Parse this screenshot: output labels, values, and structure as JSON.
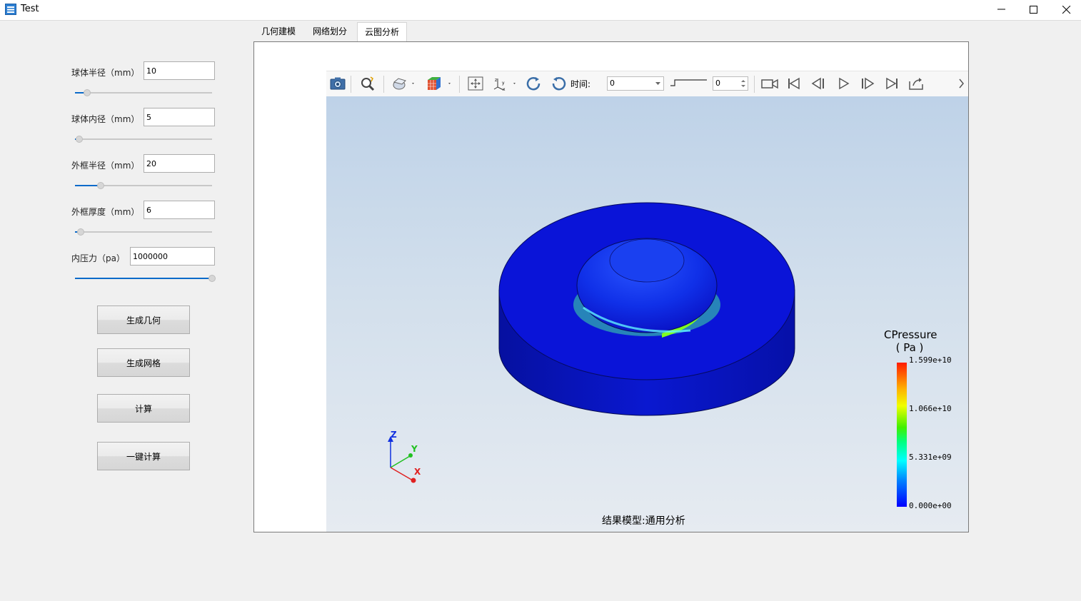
{
  "window": {
    "title": "Test"
  },
  "form": {
    "fields": [
      {
        "label": "球体半径（mm）",
        "value": "10",
        "slider_fraction": 0.09
      },
      {
        "label": "球体内径（mm）",
        "value": "5",
        "slider_fraction": 0.03
      },
      {
        "label": "外框半径（mm）",
        "value": "20",
        "slider_fraction": 0.19
      },
      {
        "label": "外框厚度（mm）",
        "value": "6",
        "slider_fraction": 0.04
      },
      {
        "label": "内压力（pa）",
        "value": "1000000",
        "slider_fraction": 1.0
      }
    ],
    "buttons": {
      "generate_geometry": "生成几何",
      "generate_mesh": "生成网格",
      "compute": "计算",
      "one_click_compute": "一键计算"
    }
  },
  "tabs": [
    {
      "label": "几何建模",
      "active": false
    },
    {
      "label": "网络划分",
      "active": false
    },
    {
      "label": "云图分析",
      "active": true
    }
  ],
  "toolbar": {
    "time_label": "时间:",
    "time_value": "0",
    "frame_value": "0",
    "icons": [
      "camera-icon",
      "zoom-icon",
      "display-mode-icon",
      "color-cube-icon",
      "fit-view-icon",
      "axes-icon",
      "rotate-icon",
      "reset-rotate-icon",
      "record-icon",
      "first-frame-icon",
      "previous-frame-icon",
      "play-icon",
      "next-frame-icon",
      "last-frame-icon",
      "export-icon"
    ]
  },
  "viewport": {
    "model_label": "结果模型:通用分析",
    "axes": {
      "z": "Z",
      "y": "Y",
      "x": "X"
    },
    "colors": {
      "model_base": "#0a14d8",
      "high": "#ff1a00"
    }
  },
  "legend": {
    "title_line1": "CPressure",
    "title_line2": "( Pa )",
    "ticks": [
      "1.599e+10",
      "1.066e+10",
      "5.331e+09",
      "0.000e+00"
    ]
  }
}
